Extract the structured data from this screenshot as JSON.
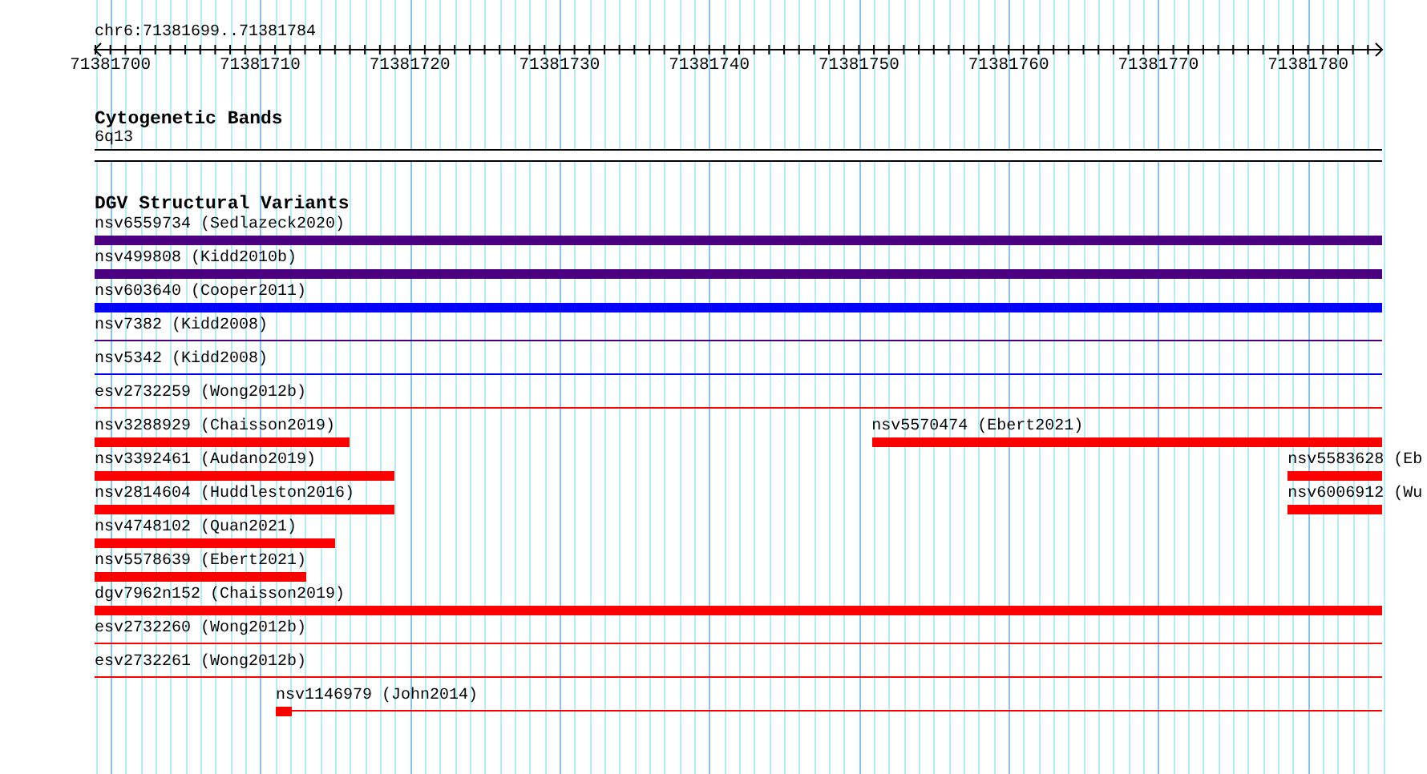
{
  "location": {
    "label": "chr6:71381699..71381784"
  },
  "ruler": {
    "ticks": [
      {
        "label": "71381700"
      },
      {
        "label": "71381710"
      },
      {
        "label": "71381720"
      },
      {
        "label": "71381730"
      },
      {
        "label": "71381740"
      },
      {
        "label": "71381750"
      },
      {
        "label": "71381760"
      },
      {
        "label": "71381770"
      },
      {
        "label": "71381780"
      }
    ]
  },
  "cytogenetic_track": {
    "title": "Cytogenetic Bands",
    "band": "6q13"
  },
  "variants_track": {
    "title": "DGV Structural Variants",
    "rows": [
      {
        "features": [
          {
            "label": "nsv6559734 (Sedlazeck2020)",
            "kind": "bar",
            "color": "#4b0082"
          }
        ]
      },
      {
        "features": [
          {
            "label": "nsv499808 (Kidd2010b)",
            "kind": "bar",
            "color": "#4b0082"
          }
        ]
      },
      {
        "features": [
          {
            "label": "nsv603640 (Cooper2011)",
            "kind": "bar",
            "color": "#0000ff"
          }
        ]
      },
      {
        "features": [
          {
            "label": "nsv7382 (Kidd2008)",
            "kind": "line",
            "color": "#4b0082"
          }
        ]
      },
      {
        "features": [
          {
            "label": "nsv5342 (Kidd2008)",
            "kind": "line",
            "color": "#0000ff"
          }
        ]
      },
      {
        "features": [
          {
            "label": "esv2732259 (Wong2012b)",
            "kind": "line",
            "color": "#ff0000"
          }
        ]
      },
      {
        "features": [
          {
            "label": "nsv3288929 (Chaisson2019)",
            "kind": "bar",
            "color": "#ff0000"
          },
          {
            "label": "nsv5570474 (Ebert2021)",
            "kind": "bar",
            "color": "#ff0000"
          }
        ]
      },
      {
        "features": [
          {
            "label": "nsv3392461 (Audano2019)",
            "kind": "bar",
            "color": "#ff0000"
          },
          {
            "label": "nsv5583628 (Eb",
            "kind": "bar",
            "color": "#ff0000"
          }
        ]
      },
      {
        "features": [
          {
            "label": "nsv2814604 (Huddleston2016)",
            "kind": "bar",
            "color": "#ff0000"
          },
          {
            "label": "nsv6006912 (Wu",
            "kind": "bar",
            "color": "#ff0000"
          }
        ]
      },
      {
        "features": [
          {
            "label": "nsv4748102 (Quan2021)",
            "kind": "bar",
            "color": "#ff0000"
          }
        ]
      },
      {
        "features": [
          {
            "label": "nsv5578639 (Ebert2021)",
            "kind": "bar",
            "color": "#ff0000"
          }
        ]
      },
      {
        "features": [
          {
            "label": "dgv7962n152 (Chaisson2019)",
            "kind": "bar",
            "color": "#ff0000"
          }
        ]
      },
      {
        "features": [
          {
            "label": "esv2732260 (Wong2012b)",
            "kind": "line",
            "color": "#ff0000"
          }
        ]
      },
      {
        "features": [
          {
            "label": "esv2732261 (Wong2012b)",
            "kind": "line",
            "color": "#ff0000"
          }
        ]
      },
      {
        "features": [
          {
            "label": "nsv1146979 (John2014)",
            "kind": "bar_line",
            "color": "#ff0000"
          }
        ]
      }
    ]
  }
}
